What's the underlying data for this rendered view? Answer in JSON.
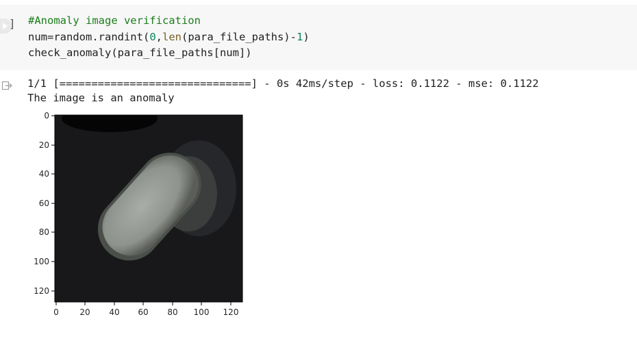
{
  "cell": {
    "execution_bracket": "]",
    "code": {
      "line1_comment": "#Anomaly image verification",
      "line2_prefix": "num=random.randint(",
      "line2_zero": "0",
      "line2_comma": ",",
      "line2_len": "len",
      "line2_mid": "(para_file_paths)",
      "line2_minus": "-",
      "line2_one": "1",
      "line2_close": ")",
      "line3": "check_anomaly(para_file_paths[num])"
    }
  },
  "output": {
    "progress_line": "1/1 [==============================] - 0s 42ms/step - loss: 0.1122 - mse: 0.1122",
    "message": "The image is an anomaly",
    "plot": {
      "y_ticks": [
        "0",
        "20",
        "40",
        "60",
        "80",
        "100",
        "120"
      ],
      "x_ticks": [
        "0",
        "20",
        "40",
        "60",
        "80",
        "100",
        "120"
      ],
      "image_description_colors": {
        "background": "#121214",
        "object": "#9ea29c"
      }
    }
  }
}
